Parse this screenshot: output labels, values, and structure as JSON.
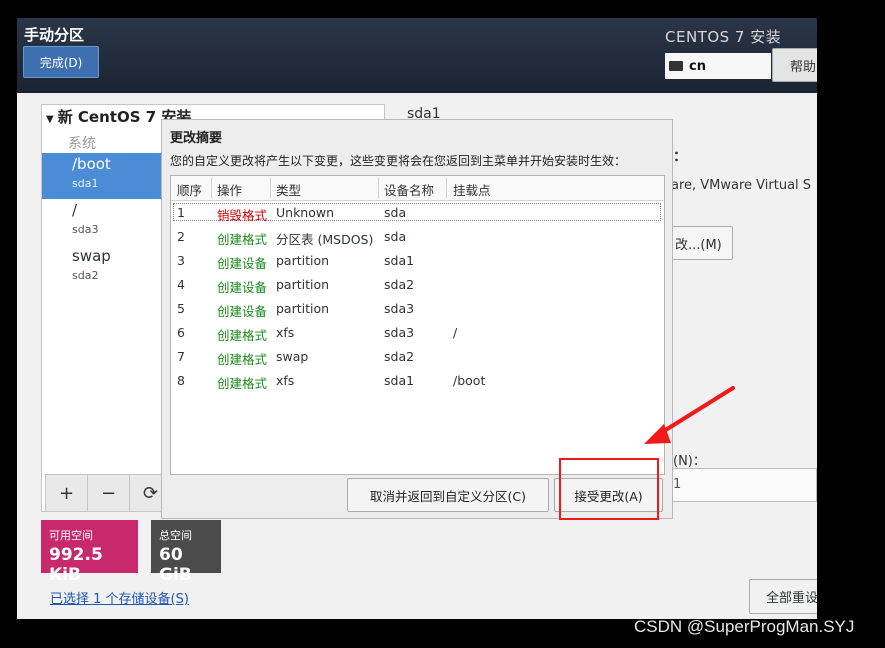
{
  "app": {
    "title": "手动分区",
    "done_label": "完成(D)",
    "product": "CENTOS 7 安装",
    "keyboard_layout": "cn",
    "help_label": "帮助"
  },
  "left": {
    "tree_header": "新 CentOS 7 安装",
    "system_label": "系统",
    "mounts": [
      {
        "mount": "/boot",
        "device": "sda1"
      },
      {
        "mount": "/",
        "device": "sda3"
      },
      {
        "mount": "swap",
        "device": "sda2"
      }
    ],
    "tools": [
      "+",
      "−",
      "⟳"
    ],
    "available_label": "可用空间",
    "available_value": "992.5 KiB",
    "total_label": "总空间",
    "total_value": "60 GiB",
    "storage_link": "已选择 1 个存储设备(S)"
  },
  "right": {
    "device_title": "sda1",
    "colon": "：",
    "device_desc": "are, VMware Virtual S",
    "modify_label": "改...(M)",
    "n_label": "(N)：",
    "field_value": "1",
    "reset_label": "全部重设"
  },
  "dialog": {
    "title": "更改摘要",
    "description": "您的自定义更改将产生以下变更，这些变更将会在您返回到主菜单并开始安装时生效：",
    "columns": [
      "顺序",
      "操作",
      "类型",
      "设备名称",
      "挂载点"
    ],
    "rows": [
      {
        "order": "1",
        "action": "销毁格式",
        "kind": "destroy",
        "type": "Unknown",
        "device": "sda",
        "mount": ""
      },
      {
        "order": "2",
        "action": "创建格式",
        "kind": "create",
        "type": "分区表 (MSDOS)",
        "device": "sda",
        "mount": ""
      },
      {
        "order": "3",
        "action": "创建设备",
        "kind": "create",
        "type": "partition",
        "device": "sda1",
        "mount": ""
      },
      {
        "order": "4",
        "action": "创建设备",
        "kind": "create",
        "type": "partition",
        "device": "sda2",
        "mount": ""
      },
      {
        "order": "5",
        "action": "创建设备",
        "kind": "create",
        "type": "partition",
        "device": "sda3",
        "mount": ""
      },
      {
        "order": "6",
        "action": "创建格式",
        "kind": "create",
        "type": "xfs",
        "device": "sda3",
        "mount": "/"
      },
      {
        "order": "7",
        "action": "创建格式",
        "kind": "create",
        "type": "swap",
        "device": "sda2",
        "mount": ""
      },
      {
        "order": "8",
        "action": "创建格式",
        "kind": "create",
        "type": "xfs",
        "device": "sda1",
        "mount": "/boot"
      }
    ],
    "cancel_label": "取消并返回到自定义分区(C)",
    "accept_label": "接受更改(A)"
  },
  "colors": {
    "destroy": "#cc0000",
    "create": "#1a8a1a",
    "highlight": "#f01a1a",
    "selected_row": "#4a8cd6"
  },
  "watermark": "CSDN @SuperProgMan.SYJ"
}
